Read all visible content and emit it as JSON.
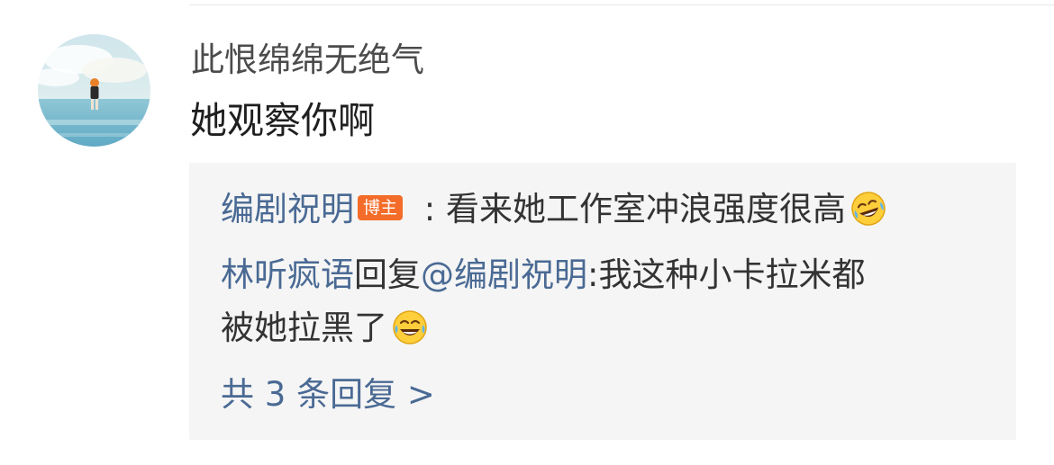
{
  "comment": {
    "username": "此恨绵绵无绝气",
    "text": "她观察你啊"
  },
  "replies": [
    {
      "author": "编剧祝明",
      "badge": "博主",
      "separator": " : ",
      "text": "看来她工作室冲浪强度很高",
      "emoji": "laugh-cry-emoji"
    },
    {
      "author": "林听疯语",
      "reply_word": "回复",
      "mention": "@编剧祝明",
      "separator": ":",
      "text_line1": "我这种小卡拉米都",
      "text_line2": "被她拉黑了",
      "emoji": "laugh-cry-emoji"
    }
  ],
  "more_replies": "共 3 条回复 >",
  "colors": {
    "link": "#4a6a94",
    "badge_bg": "#f46c2a",
    "reply_bg": "#f5f5f5",
    "text": "#1f1f1f",
    "username": "#4b4b4b"
  }
}
